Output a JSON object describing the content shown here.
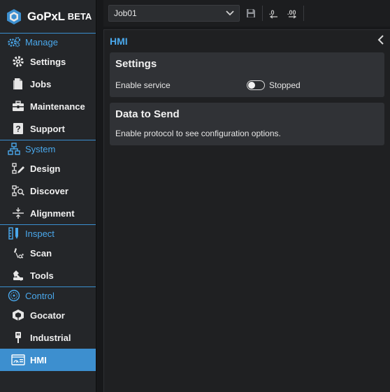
{
  "app": {
    "brand": "GoPxL",
    "badge": "BETA"
  },
  "sidebar": {
    "sections": [
      {
        "title": "Manage",
        "items": [
          {
            "label": "Settings"
          },
          {
            "label": "Jobs"
          },
          {
            "label": "Maintenance"
          },
          {
            "label": "Support"
          }
        ]
      },
      {
        "title": "System",
        "items": [
          {
            "label": "Design"
          },
          {
            "label": "Discover"
          },
          {
            "label": "Alignment"
          }
        ]
      },
      {
        "title": "Inspect",
        "items": [
          {
            "label": "Scan"
          },
          {
            "label": "Tools"
          }
        ]
      },
      {
        "title": "Control",
        "items": [
          {
            "label": "Gocator"
          },
          {
            "label": "Industrial"
          },
          {
            "label": "HMI"
          }
        ]
      }
    ],
    "active_item": "HMI"
  },
  "toolbar": {
    "job": "Job01",
    "icons": [
      "save-icon",
      "load-config-icon",
      "save-config-icon"
    ]
  },
  "panel": {
    "title": "HMI",
    "settings": {
      "title": "Settings",
      "enable_service_label": "Enable service",
      "enable_service_on": false,
      "status": "Stopped"
    },
    "data_to_send": {
      "title": "Data to Send",
      "message": "Enable protocol to see configuration options."
    }
  },
  "colors": {
    "accent": "#4aa8ec",
    "active_bg": "#3d8fcf",
    "card_bg": "#303236"
  }
}
